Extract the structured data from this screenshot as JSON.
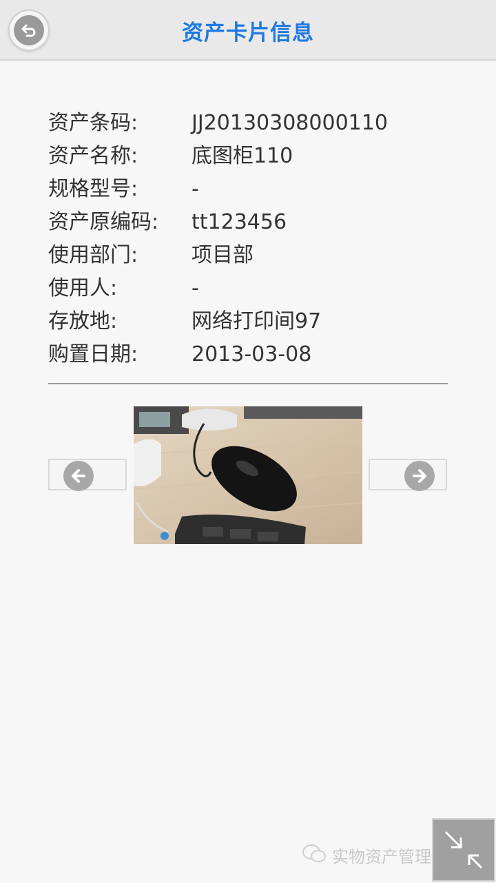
{
  "header": {
    "title": "资产卡片信息"
  },
  "asset": {
    "rows": [
      {
        "label": "资产条码:",
        "value": "JJ20130308000110"
      },
      {
        "label": "资产名称:",
        "value": "底图柜110"
      },
      {
        "label": "规格型号:",
        "value": "-"
      },
      {
        "label": "资产原编码:",
        "value": "tt123456"
      },
      {
        "label": "使用部门:",
        "value": "项目部"
      },
      {
        "label": "使用人:",
        "value": "-"
      },
      {
        "label": "存放地:",
        "value": "网络打印间97"
      },
      {
        "label": "购置日期:",
        "value": "2013-03-08"
      }
    ]
  },
  "watermark": {
    "text": "实物资产管理信息化"
  },
  "icons": {
    "back": "back-icon",
    "prev": "arrow-left-icon",
    "next": "arrow-right-icon",
    "corner": "collapse-icon",
    "wechat": "wechat-icon"
  },
  "colors": {
    "title": "#1e7ae0",
    "header_bg": "#e9e9e9",
    "background": "#f7f7f7",
    "icon_gray": "#a8a8a8"
  }
}
